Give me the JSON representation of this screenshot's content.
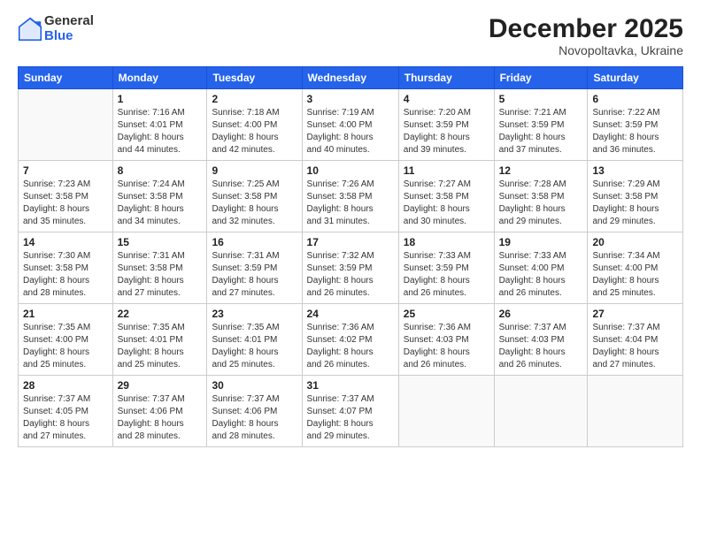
{
  "logo": {
    "general": "General",
    "blue": "Blue"
  },
  "title": {
    "month_year": "December 2025",
    "location": "Novopoltavka, Ukraine"
  },
  "weekdays": [
    "Sunday",
    "Monday",
    "Tuesday",
    "Wednesday",
    "Thursday",
    "Friday",
    "Saturday"
  ],
  "weeks": [
    [
      {
        "day": "",
        "info": ""
      },
      {
        "day": "1",
        "info": "Sunrise: 7:16 AM\nSunset: 4:01 PM\nDaylight: 8 hours\nand 44 minutes."
      },
      {
        "day": "2",
        "info": "Sunrise: 7:18 AM\nSunset: 4:00 PM\nDaylight: 8 hours\nand 42 minutes."
      },
      {
        "day": "3",
        "info": "Sunrise: 7:19 AM\nSunset: 4:00 PM\nDaylight: 8 hours\nand 40 minutes."
      },
      {
        "day": "4",
        "info": "Sunrise: 7:20 AM\nSunset: 3:59 PM\nDaylight: 8 hours\nand 39 minutes."
      },
      {
        "day": "5",
        "info": "Sunrise: 7:21 AM\nSunset: 3:59 PM\nDaylight: 8 hours\nand 37 minutes."
      },
      {
        "day": "6",
        "info": "Sunrise: 7:22 AM\nSunset: 3:59 PM\nDaylight: 8 hours\nand 36 minutes."
      }
    ],
    [
      {
        "day": "7",
        "info": "Sunrise: 7:23 AM\nSunset: 3:58 PM\nDaylight: 8 hours\nand 35 minutes."
      },
      {
        "day": "8",
        "info": "Sunrise: 7:24 AM\nSunset: 3:58 PM\nDaylight: 8 hours\nand 34 minutes."
      },
      {
        "day": "9",
        "info": "Sunrise: 7:25 AM\nSunset: 3:58 PM\nDaylight: 8 hours\nand 32 minutes."
      },
      {
        "day": "10",
        "info": "Sunrise: 7:26 AM\nSunset: 3:58 PM\nDaylight: 8 hours\nand 31 minutes."
      },
      {
        "day": "11",
        "info": "Sunrise: 7:27 AM\nSunset: 3:58 PM\nDaylight: 8 hours\nand 30 minutes."
      },
      {
        "day": "12",
        "info": "Sunrise: 7:28 AM\nSunset: 3:58 PM\nDaylight: 8 hours\nand 29 minutes."
      },
      {
        "day": "13",
        "info": "Sunrise: 7:29 AM\nSunset: 3:58 PM\nDaylight: 8 hours\nand 29 minutes."
      }
    ],
    [
      {
        "day": "14",
        "info": "Sunrise: 7:30 AM\nSunset: 3:58 PM\nDaylight: 8 hours\nand 28 minutes."
      },
      {
        "day": "15",
        "info": "Sunrise: 7:31 AM\nSunset: 3:58 PM\nDaylight: 8 hours\nand 27 minutes."
      },
      {
        "day": "16",
        "info": "Sunrise: 7:31 AM\nSunset: 3:59 PM\nDaylight: 8 hours\nand 27 minutes."
      },
      {
        "day": "17",
        "info": "Sunrise: 7:32 AM\nSunset: 3:59 PM\nDaylight: 8 hours\nand 26 minutes."
      },
      {
        "day": "18",
        "info": "Sunrise: 7:33 AM\nSunset: 3:59 PM\nDaylight: 8 hours\nand 26 minutes."
      },
      {
        "day": "19",
        "info": "Sunrise: 7:33 AM\nSunset: 4:00 PM\nDaylight: 8 hours\nand 26 minutes."
      },
      {
        "day": "20",
        "info": "Sunrise: 7:34 AM\nSunset: 4:00 PM\nDaylight: 8 hours\nand 25 minutes."
      }
    ],
    [
      {
        "day": "21",
        "info": "Sunrise: 7:35 AM\nSunset: 4:00 PM\nDaylight: 8 hours\nand 25 minutes."
      },
      {
        "day": "22",
        "info": "Sunrise: 7:35 AM\nSunset: 4:01 PM\nDaylight: 8 hours\nand 25 minutes."
      },
      {
        "day": "23",
        "info": "Sunrise: 7:35 AM\nSunset: 4:01 PM\nDaylight: 8 hours\nand 25 minutes."
      },
      {
        "day": "24",
        "info": "Sunrise: 7:36 AM\nSunset: 4:02 PM\nDaylight: 8 hours\nand 26 minutes."
      },
      {
        "day": "25",
        "info": "Sunrise: 7:36 AM\nSunset: 4:03 PM\nDaylight: 8 hours\nand 26 minutes."
      },
      {
        "day": "26",
        "info": "Sunrise: 7:37 AM\nSunset: 4:03 PM\nDaylight: 8 hours\nand 26 minutes."
      },
      {
        "day": "27",
        "info": "Sunrise: 7:37 AM\nSunset: 4:04 PM\nDaylight: 8 hours\nand 27 minutes."
      }
    ],
    [
      {
        "day": "28",
        "info": "Sunrise: 7:37 AM\nSunset: 4:05 PM\nDaylight: 8 hours\nand 27 minutes."
      },
      {
        "day": "29",
        "info": "Sunrise: 7:37 AM\nSunset: 4:06 PM\nDaylight: 8 hours\nand 28 minutes."
      },
      {
        "day": "30",
        "info": "Sunrise: 7:37 AM\nSunset: 4:06 PM\nDaylight: 8 hours\nand 28 minutes."
      },
      {
        "day": "31",
        "info": "Sunrise: 7:37 AM\nSunset: 4:07 PM\nDaylight: 8 hours\nand 29 minutes."
      },
      {
        "day": "",
        "info": ""
      },
      {
        "day": "",
        "info": ""
      },
      {
        "day": "",
        "info": ""
      }
    ]
  ]
}
